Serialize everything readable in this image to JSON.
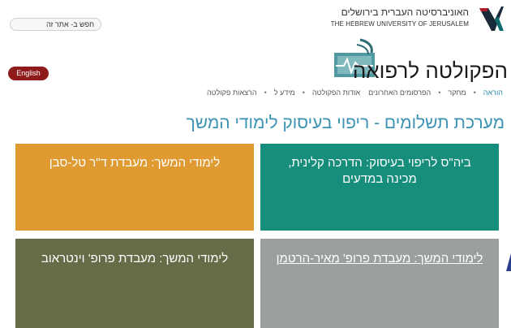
{
  "header": {
    "university_name_he": "האוניברסיטה העברית בירושלים",
    "university_name_en": "THE HEBREW UNIVERSITY OF JERUSALEM",
    "search_text": "חפש ב- אתר זה",
    "english_label": "English",
    "faculty_title": "הפקולטה לרפואה"
  },
  "nav": {
    "items": [
      {
        "label": "הוראה",
        "active": true
      },
      {
        "label": "מחקר",
        "active": false
      },
      {
        "label": "הפרסומים האחרונים",
        "active": false
      },
      {
        "label": "אודות הפקולטה",
        "active": false
      },
      {
        "label": "מידע ל",
        "active": false
      },
      {
        "label": "הרצאות פקולטה",
        "active": false
      }
    ]
  },
  "main": {
    "page_title": "מערכת תשלומים - ריפוי בעיסוק לימודי המשך",
    "tiles": [
      {
        "label": "ביה\"ס לריפוי בעיסוק: הדרכה קלינית, מכינה במדעים",
        "color": "#178e7c"
      },
      {
        "label": "לימודי המשך: מעבדת ד\"ר טל-סבן",
        "color": "#df9a32"
      },
      {
        "label": "לימודי המשך: מעבדת פרופ' וינטראוב",
        "color": "#666b48"
      },
      {
        "label": "לימודי המשך: מעבדת פרופ' מאיר-הרטמן",
        "color": "#9b9f9e"
      }
    ]
  },
  "colors": {
    "accent": "#3b92b2",
    "english_button": "#8e1a1a"
  }
}
